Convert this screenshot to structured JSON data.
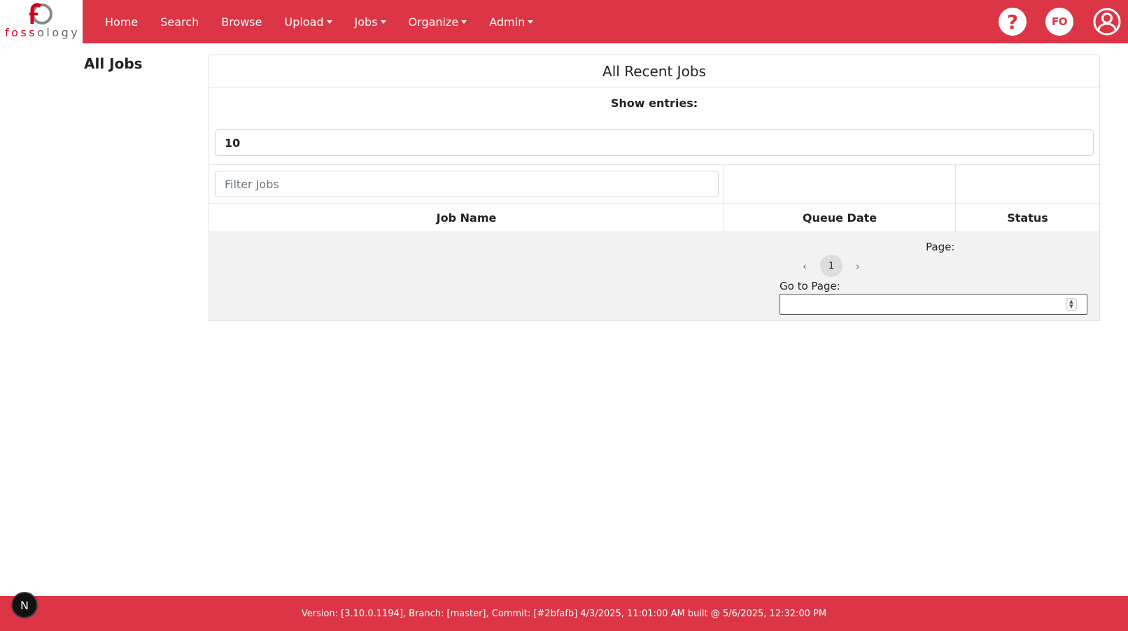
{
  "logo": {
    "text_fo": "foss",
    "text_rest": "ology"
  },
  "nav": {
    "items": [
      {
        "label": "Home",
        "dropdown": false
      },
      {
        "label": "Search",
        "dropdown": false
      },
      {
        "label": "Browse",
        "dropdown": false
      },
      {
        "label": "Upload",
        "dropdown": true
      },
      {
        "label": "Jobs",
        "dropdown": true
      },
      {
        "label": "Organize",
        "dropdown": true
      },
      {
        "label": "Admin",
        "dropdown": true
      }
    ],
    "help_label": "?",
    "user_initials": "FO",
    "user_icon": "user-circle-icon"
  },
  "page": {
    "heading": "All Jobs"
  },
  "jobs_panel": {
    "title": "All Recent Jobs",
    "show_entries_label": "Show entries:",
    "entries_value": "10",
    "filter_placeholder": "Filter Jobs",
    "columns": [
      "Job Name",
      "Queue Date",
      "Status"
    ],
    "rows": [],
    "pagination": {
      "page_label": "Page:",
      "current_page": "1",
      "goto_label": "Go to Page:",
      "goto_value": ""
    }
  },
  "footer": {
    "version_text": "Version: [3.10.0.1194], Branch: [master], Commit: [#2bfafb] 4/3/2025, 11:01:00 AM built @ 5/6/2025, 12:32:00 PM",
    "badge": "N"
  },
  "colors": {
    "brand": "#dc3545",
    "logo_red": "#d0021b"
  }
}
